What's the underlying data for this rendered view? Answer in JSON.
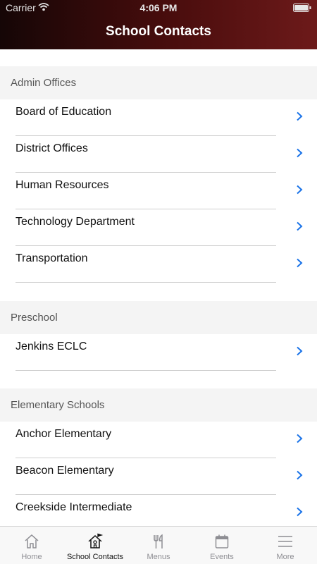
{
  "status_bar": {
    "carrier": "Carrier",
    "time": "4:06 PM"
  },
  "nav": {
    "title": "School Contacts"
  },
  "sections": [
    {
      "title": "Admin Offices",
      "items": [
        "Board of Education",
        "District Offices",
        "Human Resources",
        "Technology Department",
        "Transportation"
      ]
    },
    {
      "title": "Preschool",
      "items": [
        "Jenkins ECLC"
      ]
    },
    {
      "title": "Elementary Schools",
      "items": [
        "Anchor Elementary",
        "Beacon Elementary",
        "Creekside Intermediate"
      ]
    }
  ],
  "tabs": [
    {
      "label": "Home",
      "icon": "home-icon",
      "active": false
    },
    {
      "label": "School Contacts",
      "icon": "school-icon",
      "active": true
    },
    {
      "label": "Menus",
      "icon": "utensils-icon",
      "active": false
    },
    {
      "label": "Events",
      "icon": "calendar-icon",
      "active": false
    },
    {
      "label": "More",
      "icon": "menu-icon",
      "active": false
    }
  ],
  "colors": {
    "header_dark": "#150606",
    "header_light": "#6d1a1a",
    "accent": "#1a73e8",
    "section_bg": "#f4f4f4"
  }
}
